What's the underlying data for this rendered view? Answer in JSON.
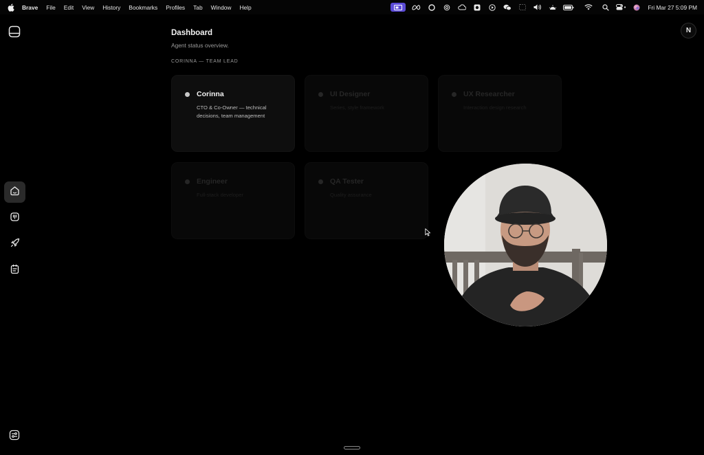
{
  "menubar": {
    "app_name": "Brave",
    "menus": [
      "File",
      "Edit",
      "View",
      "History",
      "Bookmarks",
      "Profiles",
      "Tab",
      "Window",
      "Help"
    ],
    "clock": "Fri Mar 27  5:09 PM",
    "accent": "#5b4bd6"
  },
  "header": {
    "title": "Dashboard",
    "subtitle": "Agent status overview."
  },
  "section": {
    "label": "CORINNA — TEAM LEAD"
  },
  "agents": [
    {
      "name": "Corinna",
      "desc": "CTO & Co-Owner — technical decisions, team management",
      "active": true
    },
    {
      "name": "UI Designer",
      "desc": "Series, style framework",
      "active": false
    },
    {
      "name": "UX Researcher",
      "desc": "Interaction design research",
      "active": false
    },
    {
      "name": "Engineer",
      "desc": "Full-stack developer",
      "active": false
    },
    {
      "name": "QA Tester",
      "desc": "Quality assurance",
      "active": false
    }
  ],
  "avatar": {
    "initial": "N"
  },
  "sidebar": {
    "items": [
      "home-icon",
      "agents-icon",
      "rocket-icon",
      "tasks-icon"
    ],
    "active_index": 0
  },
  "video": {
    "icon": "webcam-feed"
  }
}
